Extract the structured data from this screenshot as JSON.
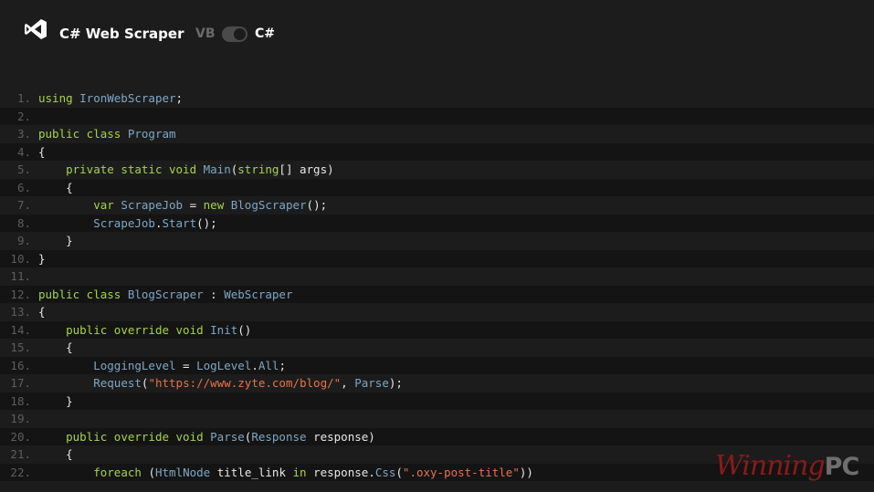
{
  "header": {
    "title": "C# Web Scraper",
    "lang_off": "VB",
    "lang_on": "C#"
  },
  "code_lines": [
    {
      "n": "1.",
      "tokens": [
        [
          "k",
          "using "
        ],
        [
          "t",
          "IronWebScraper"
        ],
        [
          "p",
          ";"
        ]
      ]
    },
    {
      "n": "2.",
      "tokens": []
    },
    {
      "n": "3.",
      "tokens": [
        [
          "k",
          "public class "
        ],
        [
          "t",
          "Program"
        ]
      ]
    },
    {
      "n": "4.",
      "tokens": [
        [
          "p",
          "{"
        ]
      ]
    },
    {
      "n": "5.",
      "tokens": [
        [
          "p",
          "    "
        ],
        [
          "k",
          "private static void "
        ],
        [
          "t",
          "Main"
        ],
        [
          "p",
          "("
        ],
        [
          "k",
          "string"
        ],
        [
          "p",
          "[] args)"
        ]
      ]
    },
    {
      "n": "6.",
      "tokens": [
        [
          "p",
          "    {"
        ]
      ]
    },
    {
      "n": "7.",
      "tokens": [
        [
          "p",
          "        "
        ],
        [
          "k",
          "var "
        ],
        [
          "t",
          "ScrapeJob"
        ],
        [
          "p",
          " = "
        ],
        [
          "k",
          "new "
        ],
        [
          "t",
          "BlogScraper"
        ],
        [
          "p",
          "();"
        ]
      ]
    },
    {
      "n": "8.",
      "tokens": [
        [
          "p",
          "        "
        ],
        [
          "t",
          "ScrapeJob"
        ],
        [
          "p",
          "."
        ],
        [
          "t",
          "Start"
        ],
        [
          "p",
          "();"
        ]
      ]
    },
    {
      "n": "9.",
      "tokens": [
        [
          "p",
          "    }"
        ]
      ]
    },
    {
      "n": "10.",
      "tokens": [
        [
          "p",
          "}"
        ]
      ]
    },
    {
      "n": "11.",
      "tokens": []
    },
    {
      "n": "12.",
      "tokens": [
        [
          "k",
          "public class "
        ],
        [
          "t",
          "BlogScraper"
        ],
        [
          "p",
          " : "
        ],
        [
          "t",
          "WebScraper"
        ]
      ]
    },
    {
      "n": "13.",
      "tokens": [
        [
          "p",
          "{"
        ]
      ]
    },
    {
      "n": "14.",
      "tokens": [
        [
          "p",
          "    "
        ],
        [
          "k",
          "public override void "
        ],
        [
          "t",
          "Init"
        ],
        [
          "p",
          "()"
        ]
      ]
    },
    {
      "n": "15.",
      "tokens": [
        [
          "p",
          "    {"
        ]
      ]
    },
    {
      "n": "16.",
      "tokens": [
        [
          "p",
          "        "
        ],
        [
          "t",
          "LoggingLevel"
        ],
        [
          "p",
          " = "
        ],
        [
          "t",
          "LogLevel"
        ],
        [
          "p",
          "."
        ],
        [
          "t",
          "All"
        ],
        [
          "p",
          ";"
        ]
      ]
    },
    {
      "n": "17.",
      "tokens": [
        [
          "p",
          "        "
        ],
        [
          "t",
          "Request"
        ],
        [
          "p",
          "("
        ],
        [
          "s",
          "\"https://www.zyte.com/blog/\""
        ],
        [
          "p",
          ", "
        ],
        [
          "t",
          "Parse"
        ],
        [
          "p",
          ");"
        ]
      ]
    },
    {
      "n": "18.",
      "tokens": [
        [
          "p",
          "    }"
        ]
      ]
    },
    {
      "n": "19.",
      "tokens": []
    },
    {
      "n": "20.",
      "tokens": [
        [
          "p",
          "    "
        ],
        [
          "k",
          "public override void "
        ],
        [
          "t",
          "Parse"
        ],
        [
          "p",
          "("
        ],
        [
          "t",
          "Response"
        ],
        [
          "p",
          " response)"
        ]
      ]
    },
    {
      "n": "21.",
      "tokens": [
        [
          "p",
          "    {"
        ]
      ]
    },
    {
      "n": "22.",
      "tokens": [
        [
          "p",
          "        "
        ],
        [
          "k",
          "foreach "
        ],
        [
          "p",
          "("
        ],
        [
          "t",
          "HtmlNode"
        ],
        [
          "p",
          " title_link "
        ],
        [
          "k",
          "in "
        ],
        [
          "p",
          "response."
        ],
        [
          "t",
          "Css"
        ],
        [
          "p",
          "("
        ],
        [
          "s",
          "\".oxy-post-title\""
        ],
        [
          "p",
          "))"
        ]
      ]
    }
  ],
  "watermark": {
    "word": "Winning",
    "suffix": "PC"
  },
  "colors": {
    "background": "#1c1c1c",
    "keyword": "#a6d44a",
    "type": "#7fa7c6",
    "string": "#e8734a"
  }
}
